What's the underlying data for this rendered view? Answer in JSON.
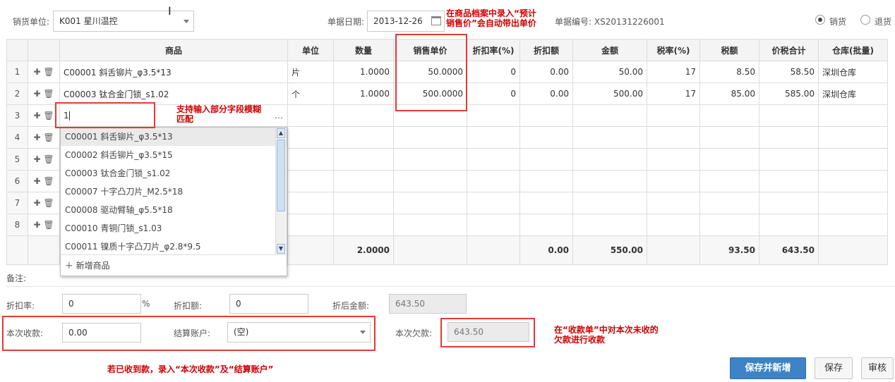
{
  "header": {
    "seller_label": "销货单位:",
    "seller_value": "K001 星川温控",
    "date_label": "单据日期:",
    "date_value": "2013-12-26",
    "doc_no": "单据编号: XS20131226001",
    "radio_sale": "销货",
    "radio_return": "退货",
    "selected_radio": "销货"
  },
  "grid": {
    "columns": [
      "商品",
      "单位",
      "数量",
      "销售单价",
      "折扣率(%)",
      "折扣额",
      "金额",
      "税率(%)",
      "税额",
      "价税合计",
      "仓库(批量)"
    ],
    "rows": [
      {
        "n": "1",
        "item": "C00001 斜舌铆片_φ3.5*13",
        "unit": "片",
        "qty": "1.0000",
        "price": "50.0000",
        "disc_rate": "0",
        "disc_amt": "0.00",
        "amount": "50.00",
        "tax_rate": "17",
        "tax": "8.50",
        "total": "58.50",
        "wh": "深圳仓库"
      },
      {
        "n": "2",
        "item": "C00003 钛合金门锁_s1.02",
        "unit": "个",
        "qty": "1.0000",
        "price": "500.0000",
        "disc_rate": "0",
        "disc_amt": "0.00",
        "amount": "500.00",
        "tax_rate": "17",
        "tax": "85.00",
        "total": "585.00",
        "wh": "深圳仓库"
      },
      {
        "n": "3",
        "item_input": "1"
      },
      {
        "n": "4"
      },
      {
        "n": "5"
      },
      {
        "n": "6"
      },
      {
        "n": "7"
      },
      {
        "n": "8"
      }
    ],
    "totals": {
      "qty": "2.0000",
      "disc_amt": "0.00",
      "amount": "550.00",
      "tax": "93.50",
      "total": "643.50"
    }
  },
  "dropdown": {
    "items": [
      "C00001 斜舌铆片_φ3.5*13",
      "C00002 斜舌铆片_φ3.5*15",
      "C00003 钛合金门锁_s1.02",
      "C00007 十字凸刀片_M2.5*18",
      "C00008 驱动臂轴_φ5.5*18",
      "C00010 青铜门锁_s1.03",
      "C00011 镍质十字凸刀片_φ2.8*9.5"
    ],
    "add_label": "新增商品"
  },
  "footer": {
    "remark_label": "备注:",
    "disc_rate_label": "折扣率:",
    "disc_rate_value": "0",
    "percent": "%",
    "disc_amt_label": "折扣额:",
    "disc_amt_value": "0",
    "after_disc_label": "折后金额:",
    "after_disc_value": "643.50",
    "received_label": "本次收款:",
    "received_value": "0.00",
    "account_label": "结算账户:",
    "account_value": "(空)",
    "owed_label": "本次欠款:",
    "owed_value": "643.50"
  },
  "buttons": {
    "save_new": "保存并新增",
    "save": "保存",
    "audit": "审核"
  },
  "annotations": {
    "price_1": "在商品档案中录入“预计",
    "price_2": "销售价”会自动带出单价",
    "fuzzy_1": "支持输入部分字段模糊",
    "fuzzy_2": "匹配",
    "receipt_1": "在“收款单”中对本次未收的",
    "receipt_2": "欠款进行收款",
    "received_note": "若已收到款，录入“本次收款”及“结算账户”"
  },
  "colors": {
    "annotation": "#d00000",
    "primary_button": "#3d84c6",
    "highlight_box": "#e53935"
  }
}
